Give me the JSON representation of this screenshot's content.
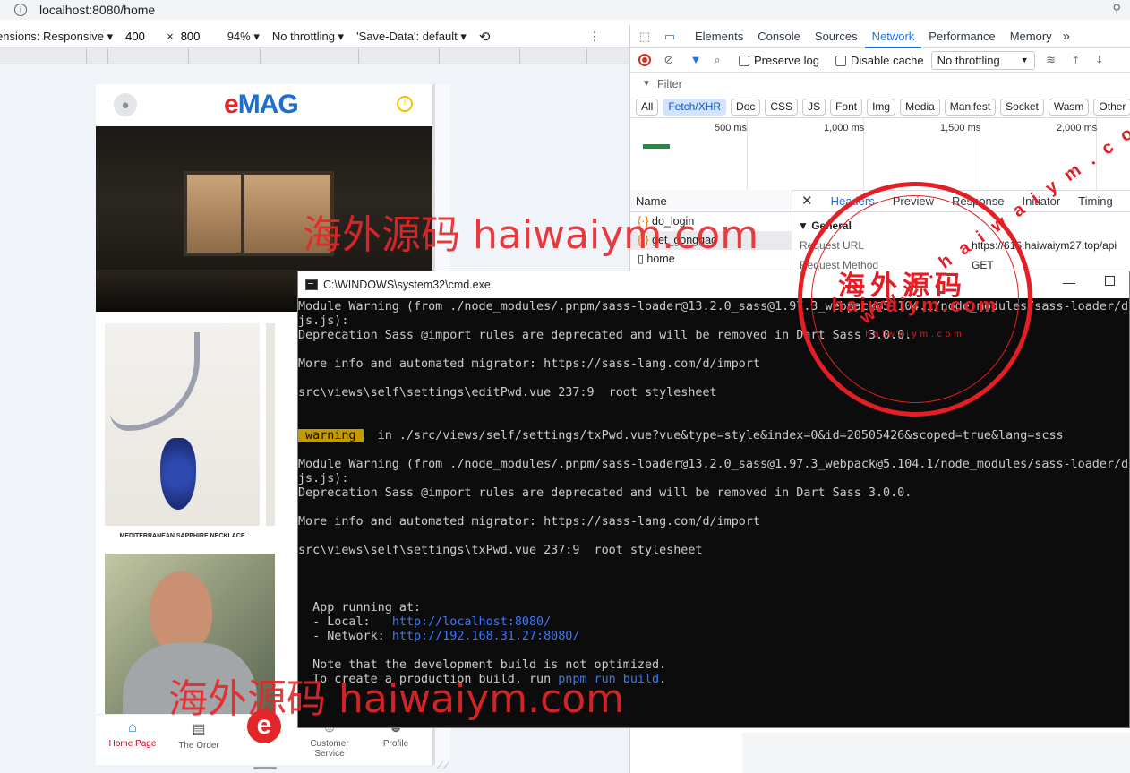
{
  "browser": {
    "url": "localhost:8080/home"
  },
  "device_toolbar": {
    "dimensions_label": "ensions: Responsive ▾",
    "width": "400",
    "times": "×",
    "height": "800",
    "zoom": "94% ▾",
    "throttling": "No throttling ▾",
    "save_data": "'Save-Data': default ▾",
    "more": "⋮"
  },
  "app": {
    "logo_e": "e",
    "logo_rest": "MAG",
    "product_caption": "MEDITERRANEAN SAPPHIRE NECKLACE",
    "tabs": [
      {
        "label": "Home Page",
        "icon": "⌂"
      },
      {
        "label": "The Order",
        "icon": "▤"
      },
      {
        "label": "",
        "icon": "e"
      },
      {
        "label": "Customer Service",
        "icon": "☺"
      },
      {
        "label": "Profile",
        "icon": "☻"
      }
    ]
  },
  "devtools": {
    "tabs": [
      "Elements",
      "Console",
      "Sources",
      "Network",
      "Performance",
      "Memory"
    ],
    "more_tabs": "»",
    "preserve_log": "Preserve log",
    "disable_cache": "Disable cache",
    "throttling": "No throttling",
    "filter_label": "Filter",
    "chips": [
      "All",
      "Fetch/XHR",
      "Doc",
      "CSS",
      "JS",
      "Font",
      "Img",
      "Media",
      "Manifest",
      "Socket",
      "Wasm",
      "Other"
    ],
    "timeline_labels": [
      "500 ms",
      "1,000 ms",
      "1,500 ms",
      "2,000 ms"
    ],
    "name_header": "Name",
    "requests": [
      "do_login",
      "get_gonggao",
      "home"
    ],
    "detail_tabs": [
      "Headers",
      "Preview",
      "Response",
      "Initiator",
      "Timing"
    ],
    "general_label": "▼ General",
    "request_url_label": "Request URL",
    "request_url_value": "https://616.haiwaiym27.top/api",
    "request_method_label": "Request Method",
    "request_method_value": "GET"
  },
  "cmd": {
    "title": "C:\\WINDOWS\\system32\\cmd.exe",
    "min": "—",
    "lines": [
      "Module Warning (from ./node_modules/.pnpm/sass-loader@13.2.0_sass@1.97.3_webpack@5.104.1/node_modules/sass-loader/dis",
      "js.js):",
      "Deprecation Sass @import rules are deprecated and will be removed in Dart Sass 3.0.0.",
      "",
      "More info and automated migrator: https://sass-lang.com/d/import",
      "",
      "src\\views\\self\\settings\\editPwd.vue 237:9  root stylesheet",
      "",
      ""
    ],
    "warning_tag": " warning ",
    "warning_text": "  in ./src/views/self/settings/txPwd.vue?vue&type=style&index=0&id=20505426&scoped=true&lang=scss",
    "lines2": [
      "",
      "Module Warning (from ./node_modules/.pnpm/sass-loader@13.2.0_sass@1.97.3_webpack@5.104.1/node_modules/sass-loader/dis",
      "js.js):",
      "Deprecation Sass @import rules are deprecated and will be removed in Dart Sass 3.0.0.",
      "",
      "More info and automated migrator: https://sass-lang.com/d/import",
      "",
      "src\\views\\self\\settings\\txPwd.vue 237:9  root stylesheet",
      "",
      "",
      "",
      "  App running at:"
    ],
    "local_label": "  - Local:   ",
    "local_url": "http://localhost:8080/",
    "network_label": "  - Network: ",
    "network_url": "http://192.168.31.27:8080/",
    "note1": "  Note that the development build is not optimized.",
    "note2_pre": "  To create a production build, run ",
    "note2_cmd": "pnpm run build",
    "note2_post": "."
  },
  "watermark": {
    "text": "海外源码 haiwaiym.com",
    "stamp_cn": "海外源码",
    "stamp_domain": "haiwaiym.com",
    "stamp_small": "haiwaiym.com",
    "stamp_arc": "www.haiwaiym.com"
  },
  "colors": {
    "accent": "#1a73e8",
    "brand_red": "#e3262a",
    "brand_blue": "#1a6fd1",
    "terminal_bg": "#0c0c0c",
    "watermark": "#e8262a"
  }
}
